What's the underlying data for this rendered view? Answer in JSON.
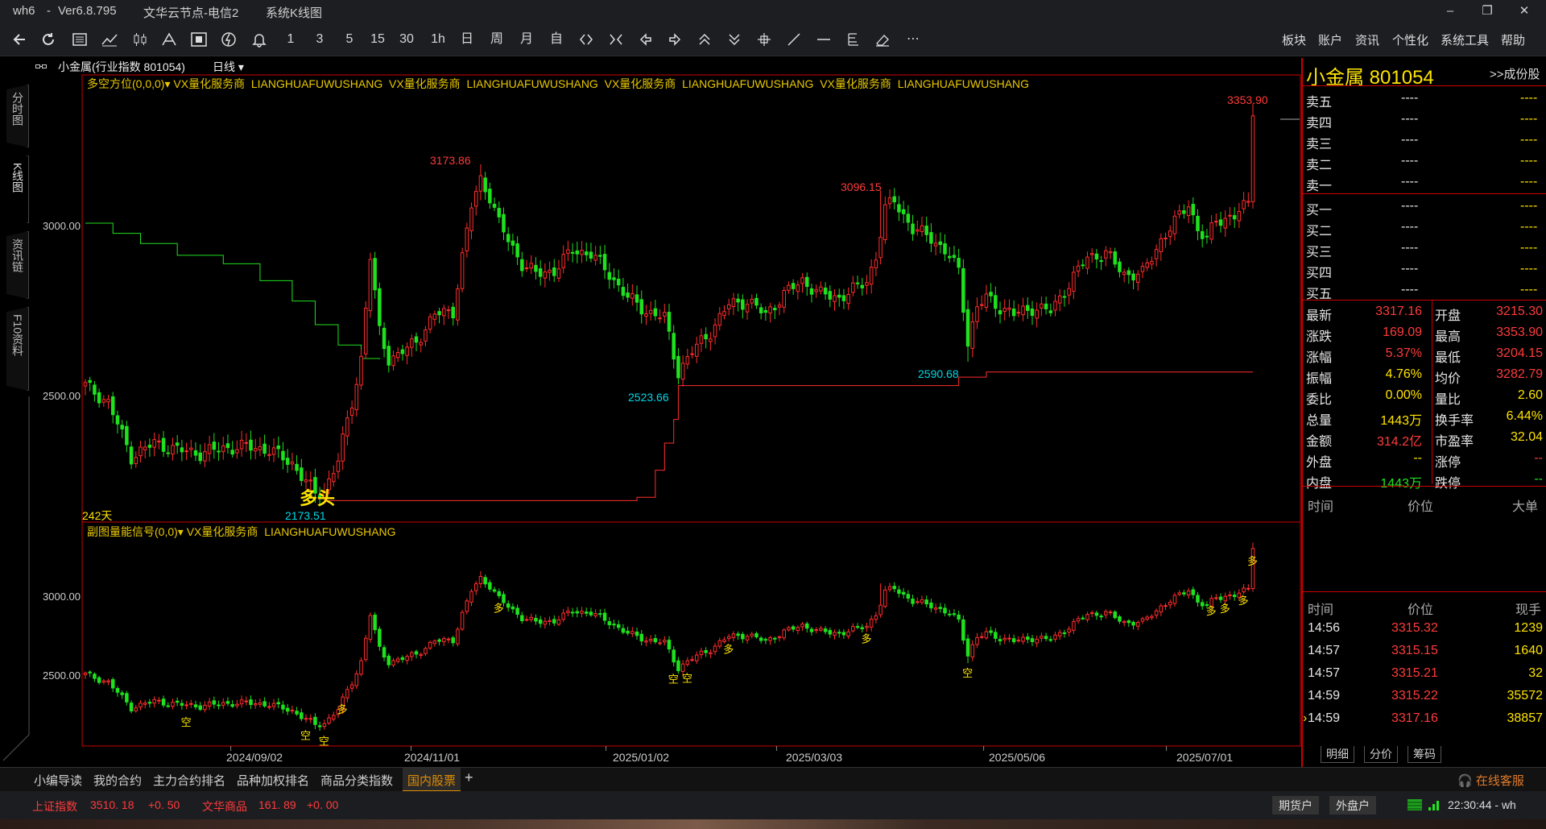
{
  "window": {
    "app": "wh6",
    "version": "Ver6.8.795",
    "node": "文华云节点-电信2",
    "chart_mode": "系统K线图",
    "minimize": "–",
    "restore": "❐",
    "close": "✕"
  },
  "toolbar": {
    "periods": [
      "1",
      "3",
      "5",
      "15",
      "30",
      "1h",
      "日",
      "周",
      "月",
      "自"
    ],
    "menus": [
      "板块",
      "账户",
      "资讯",
      "个性化",
      "系统工具",
      "帮助"
    ],
    "more": "⋯"
  },
  "left_tabs": [
    {
      "label": "分时图"
    },
    {
      "label": "K线图"
    },
    {
      "label": "资讯链"
    },
    {
      "label": "F10资料"
    }
  ],
  "chart_header": {
    "name": "小金属(行业指数 801054)",
    "period": "日线"
  },
  "upper_legend": {
    "indicator": "多空方位(0,0,0)",
    "items": [
      "VX量化服务商",
      "LIANGHUAFUWUSHANG",
      "VX量化服务商",
      "LIANGHUAFUWUSHANG",
      "VX量化服务商",
      "LIANGHUAFUWUSHANG",
      "VX量化服务商",
      "LIANGHUAFUWUSHANG"
    ]
  },
  "lower_legend": {
    "indicator": "副图量能信号(0,0)",
    "items": [
      "VX量化服务商",
      "LIANGHUAFUWUSHANG"
    ]
  },
  "upper_chart": {
    "y_ticks": [
      "3000.00",
      "2500.00"
    ],
    "price_labels": {
      "high1": "3173.86",
      "high2": "3096.15",
      "high3": "3353.90",
      "low1": "2173.51",
      "low2": "2523.66",
      "low3": "2590.68"
    },
    "signal": "多头",
    "days": "242天"
  },
  "lower_chart": {
    "y_ticks": [
      "3000.00",
      "2500.00"
    ],
    "signals": {
      "long": "多",
      "short": "空"
    }
  },
  "x_axis": [
    "2024/09/02",
    "2024/11/01",
    "2025/01/02",
    "2025/03/03",
    "2025/05/06",
    "2025/07/01"
  ],
  "colors": {
    "up": "#ff2d2d",
    "down": "#1fe11f",
    "border": "#cc0000",
    "legend": "#e8c800",
    "low_label": "#00d8e8"
  },
  "chart_data": {
    "type": "candlestick",
    "title": "小金属(行业指数 801054)",
    "period": "日线",
    "ylim": [
      2100,
      3400
    ],
    "y_ticks": [
      2500,
      3000
    ],
    "x_ticks": [
      "2024/09/02",
      "2024/11/01",
      "2025/01/02",
      "2025/03/03",
      "2025/05/06",
      "2025/07/01"
    ],
    "close_keypoints": [
      [
        0,
        2520
      ],
      [
        5,
        2470
      ],
      [
        10,
        2310
      ],
      [
        15,
        2350
      ],
      [
        20,
        2330
      ],
      [
        25,
        2320
      ],
      [
        30,
        2335
      ],
      [
        35,
        2340
      ],
      [
        40,
        2330
      ],
      [
        45,
        2290
      ],
      [
        50,
        2200
      ],
      [
        52,
        2210
      ],
      [
        55,
        2300
      ],
      [
        58,
        2470
      ],
      [
        60,
        2600
      ],
      [
        62,
        2900
      ],
      [
        64,
        2680
      ],
      [
        66,
        2600
      ],
      [
        68,
        2610
      ],
      [
        72,
        2650
      ],
      [
        76,
        2730
      ],
      [
        80,
        2740
      ],
      [
        82,
        2900
      ],
      [
        84,
        3050
      ],
      [
        86,
        3130
      ],
      [
        88,
        3080
      ],
      [
        90,
        3000
      ],
      [
        92,
        2950
      ],
      [
        95,
        2880
      ],
      [
        98,
        2850
      ],
      [
        102,
        2860
      ],
      [
        106,
        2920
      ],
      [
        110,
        2910
      ],
      [
        114,
        2850
      ],
      [
        118,
        2780
      ],
      [
        122,
        2740
      ],
      [
        126,
        2720
      ],
      [
        129,
        2560
      ],
      [
        132,
        2620
      ],
      [
        136,
        2680
      ],
      [
        140,
        2760
      ],
      [
        144,
        2770
      ],
      [
        148,
        2730
      ],
      [
        152,
        2790
      ],
      [
        156,
        2830
      ],
      [
        160,
        2790
      ],
      [
        164,
        2780
      ],
      [
        168,
        2810
      ],
      [
        170,
        2830
      ],
      [
        172,
        2900
      ],
      [
        174,
        3040
      ],
      [
        176,
        3070
      ],
      [
        180,
        2980
      ],
      [
        184,
        2960
      ],
      [
        188,
        2900
      ],
      [
        190,
        2860
      ],
      [
        192,
        2650
      ],
      [
        194,
        2750
      ],
      [
        196,
        2780
      ],
      [
        198,
        2760
      ],
      [
        202,
        2730
      ],
      [
        206,
        2750
      ],
      [
        210,
        2740
      ],
      [
        214,
        2820
      ],
      [
        218,
        2900
      ],
      [
        222,
        2910
      ],
      [
        226,
        2850
      ],
      [
        230,
        2850
      ],
      [
        234,
        2950
      ],
      [
        238,
        3020
      ],
      [
        240,
        3060
      ],
      [
        242,
        2980
      ],
      [
        244,
        2950
      ],
      [
        246,
        3010
      ],
      [
        250,
        3020
      ],
      [
        253,
        3060
      ],
      [
        254,
        3317.16
      ]
    ],
    "highs": [
      [
        86,
        3173.86
      ],
      [
        173,
        3096.15
      ],
      [
        254,
        3353.9
      ]
    ],
    "lows": [
      [
        50,
        2173.51
      ],
      [
        129,
        2523.66
      ],
      [
        192,
        2590.68
      ]
    ],
    "last_close": 3317.16
  },
  "quote": {
    "name": "小金属",
    "code": "801054",
    "constituents": ">>成份股",
    "asks": [
      {
        "label": "卖五",
        "price": "----",
        "vol": "----"
      },
      {
        "label": "卖四",
        "price": "----",
        "vol": "----"
      },
      {
        "label": "卖三",
        "price": "----",
        "vol": "----"
      },
      {
        "label": "卖二",
        "price": "----",
        "vol": "----"
      },
      {
        "label": "卖一",
        "price": "----",
        "vol": "----"
      }
    ],
    "bids": [
      {
        "label": "买一",
        "price": "----",
        "vol": "----"
      },
      {
        "label": "买二",
        "price": "----",
        "vol": "----"
      },
      {
        "label": "买三",
        "price": "----",
        "vol": "----"
      },
      {
        "label": "买四",
        "price": "----",
        "vol": "----"
      },
      {
        "label": "买五",
        "price": "----",
        "vol": "----"
      }
    ],
    "stats": [
      {
        "l1": "最新",
        "v1": "3317.16",
        "c1": "red",
        "l2": "开盘",
        "v2": "3215.30",
        "c2": "red"
      },
      {
        "l1": "涨跌",
        "v1": "169.09",
        "c1": "red",
        "l2": "最高",
        "v2": "3353.90",
        "c2": "red"
      },
      {
        "l1": "涨幅",
        "v1": "5.37%",
        "c1": "red",
        "l2": "最低",
        "v2": "3204.15",
        "c2": "red"
      },
      {
        "l1": "振幅",
        "v1": "4.76%",
        "c1": "yellow",
        "l2": "均价",
        "v2": "3282.79",
        "c2": "red"
      },
      {
        "l1": "委比",
        "v1": "0.00%",
        "c1": "yellow",
        "l2": "量比",
        "v2": "2.60",
        "c2": "yellow"
      },
      {
        "l1": "总量",
        "v1": "1443万",
        "c1": "yellow",
        "l2": "换手率",
        "v2": "6.44%",
        "c2": "yellow"
      },
      {
        "l1": "金额",
        "v1": "314.2亿",
        "c1": "red",
        "l2": "市盈率",
        "v2": "32.04",
        "c2": "yellow"
      },
      {
        "l1": "外盘",
        "v1": "--",
        "c1": "yellow",
        "l2": "涨停",
        "v2": "--",
        "c2": "red"
      },
      {
        "l1": "内盘",
        "v1": "1443万",
        "c1": "green",
        "l2": "跌停",
        "v2": "--",
        "c2": "green"
      }
    ],
    "ticks_header": {
      "time": "时间",
      "price": "价位",
      "big": "大单"
    },
    "trades_header": {
      "time": "时间",
      "price": "价位",
      "vol": "现手"
    },
    "trades": [
      {
        "time": "14:56",
        "price": "3315.32",
        "vol": "1239"
      },
      {
        "time": "14:57",
        "price": "3315.15",
        "vol": "1640"
      },
      {
        "time": "14:57",
        "price": "3315.21",
        "vol": "32"
      },
      {
        "time": "14:59",
        "price": "3315.22",
        "vol": "35572"
      },
      {
        "time": "14:59",
        "price": "3317.16",
        "vol": "38857"
      }
    ],
    "bottom_tabs": [
      "明细",
      "分价",
      "筹码"
    ]
  },
  "bottom_tabs": {
    "items": [
      "小编导读",
      "我的合约",
      "主力合约排名",
      "品种加权排名",
      "商品分类指数",
      "国内股票"
    ],
    "add": "+",
    "service": "在线客服"
  },
  "status": {
    "idx1_name": "上证指数",
    "idx1_val": "3510. 18",
    "idx1_chg": "+0. 50",
    "idx2_name": "文华商品",
    "idx2_val": "161. 89",
    "idx2_chg": "+0. 00",
    "btn1": "期货户",
    "btn2": "外盘户",
    "time": "22:30:44 - wh"
  }
}
